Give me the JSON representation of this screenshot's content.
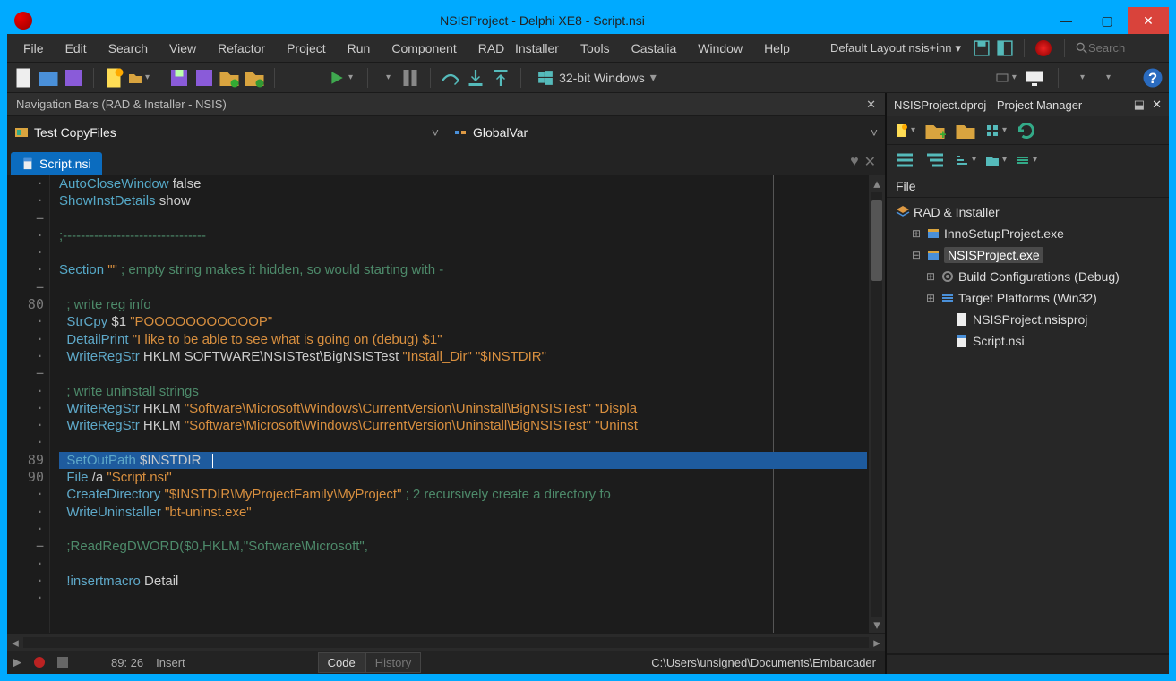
{
  "window": {
    "title": "NSISProject - Delphi XE8 - Script.nsi"
  },
  "menu": {
    "items": [
      "File",
      "Edit",
      "Search",
      "View",
      "Refactor",
      "Project",
      "Run",
      "Component",
      "RAD _Installer",
      "Tools",
      "Castalia",
      "Window",
      "Help"
    ],
    "layout": "Default Layout nsis+inn",
    "search_placeholder": "Search"
  },
  "toolbar": {
    "platform": "32-bit Windows"
  },
  "nav": {
    "title": "Navigation Bars (RAD & Installer - NSIS)",
    "combo1": "Test CopyFiles",
    "combo2": "GlobalVar"
  },
  "tab": {
    "filename": "Script.nsi"
  },
  "gutter": "  ·\n  ·\n  −\n  ·\n  ·\n  ·\n  −\n 80\n  ·\n  ·\n  ·\n  −\n  ·\n  ·\n  ·\n  ·\n 89\n 90\n  ·\n  ·\n  ·\n  −\n  ·\n  ·\n  ·",
  "code": {
    "l1_a": "AutoCloseWindow",
    "l1_b": " false",
    "l2_a": "ShowInstDetails",
    "l2_b": " show",
    "l3": "",
    "l4": ";--------------------------------",
    "l5": "",
    "l6_a": "Section",
    "l6_b": " \"\"",
    "l6_c": " ; empty string makes it hidden, so would starting with -",
    "l7": "",
    "l8": "  ; write reg info",
    "l9_a": "  StrCpy",
    "l9_b": " $1",
    "l9_c": " \"POOOOOOOOOOOP\"",
    "l10_a": "  DetailPrint",
    "l10_b": " \"I like to be able to see what is going on (debug) $1\"",
    "l11_a": "  WriteRegStr",
    "l11_b": " HKLM",
    "l11_c": " SOFTWARE\\NSISTest\\BigNSISTest",
    "l11_d": " \"Install_Dir\"",
    "l11_e": " \"$INSTDIR\"",
    "l12": "",
    "l13": "  ; write uninstall strings",
    "l14_a": "  WriteRegStr",
    "l14_b": " HKLM",
    "l14_c": " \"Software\\Microsoft\\Windows\\CurrentVersion\\Uninstall\\BigNSISTest\"",
    "l14_d": " \"Displa",
    "l15_a": "  WriteRegStr",
    "l15_b": " HKLM",
    "l15_c": " \"Software\\Microsoft\\Windows\\CurrentVersion\\Uninstall\\BigNSISTest\"",
    "l15_d": " \"Uninst",
    "l16": "",
    "l17_a": "  SetOutPath",
    "l17_b": " $INSTDIR   ",
    "l18_a": "  File",
    "l18_b": " /a",
    "l18_c": " \"Script.nsi\"",
    "l19_a": "  CreateDirectory",
    "l19_b": " \"$INSTDIR\\MyProjectFamily\\MyProject\"",
    "l19_c": " ; 2 recursively create a directory fo",
    "l20_a": "  WriteUninstaller",
    "l20_b": " \"bt-uninst.exe\"",
    "l21": "",
    "l22": "  ;ReadRegDWORD($0,HKLM,\"Software\\Microsoft\",",
    "l23": "",
    "l24_a": "  !insertmacro",
    "l24_b": " Detail",
    "l25": ""
  },
  "status": {
    "pos": "89: 26",
    "mode": "Insert",
    "tab_code": "Code",
    "tab_history": "History",
    "path": "C:\\Users\\unsigned\\Documents\\Embarcader"
  },
  "project_manager": {
    "title": "NSISProject.dproj - Project Manager",
    "section": "File",
    "root": "RAD & Installer",
    "items": {
      "inno": "InnoSetupProject.exe",
      "nsis": "NSISProject.exe",
      "build": "Build Configurations (Debug)",
      "target": "Target Platforms (Win32)",
      "proj": "NSISProject.nsisproj",
      "script": "Script.nsi"
    }
  }
}
